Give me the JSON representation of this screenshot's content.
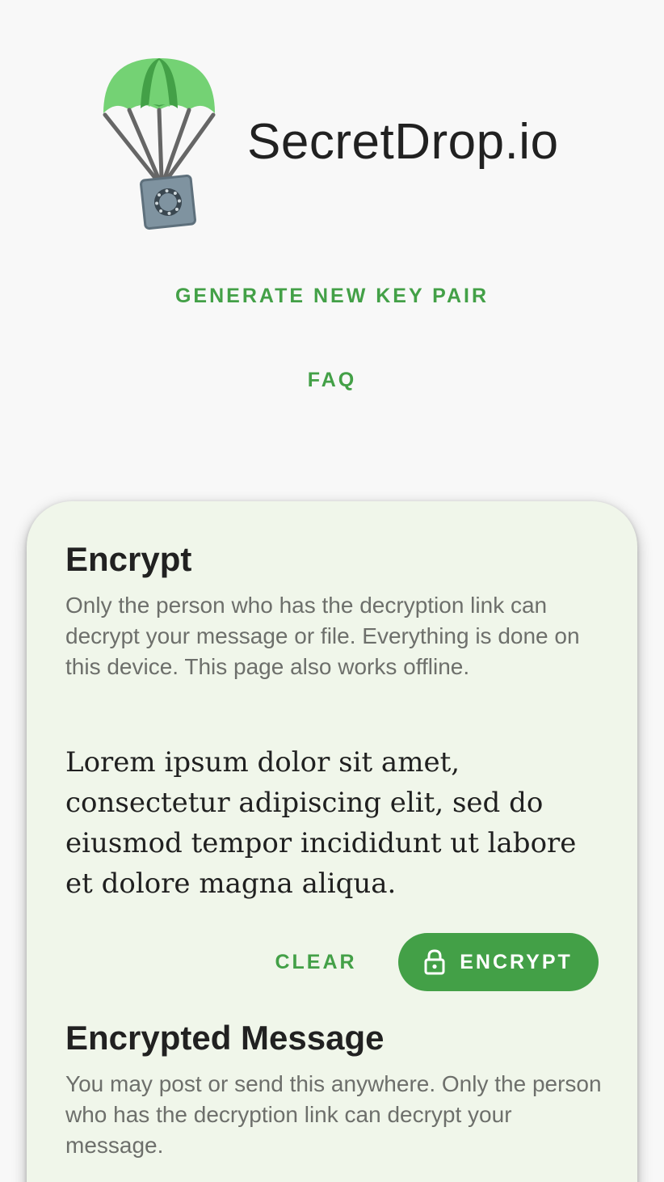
{
  "header": {
    "brand": "SecretDrop.io",
    "logo_icon": "parachute-safe-icon"
  },
  "nav": {
    "generate_label": "GENERATE NEW KEY PAIR",
    "faq_label": "FAQ"
  },
  "encrypt_section": {
    "title": "Encrypt",
    "description": "Only the person who has the decryption link can decrypt your message or file. Everything is done on this device. This page also works offline.",
    "message": "Lorem ipsum dolor sit amet, consectetur adipiscing elit, sed do eiusmod tempor incididunt ut labore et dolore magna aliqua.",
    "clear_label": "CLEAR",
    "encrypt_label": "ENCRYPT",
    "encrypt_icon": "lock-icon"
  },
  "encrypted_section": {
    "title": "Encrypted Message",
    "description": "You may post or send this anywhere. Only the person who has the decryption link can decrypt your message."
  },
  "colors": {
    "accent": "#43a047",
    "card_background": "#f0f6ea",
    "page_background": "#f8f8f8"
  }
}
